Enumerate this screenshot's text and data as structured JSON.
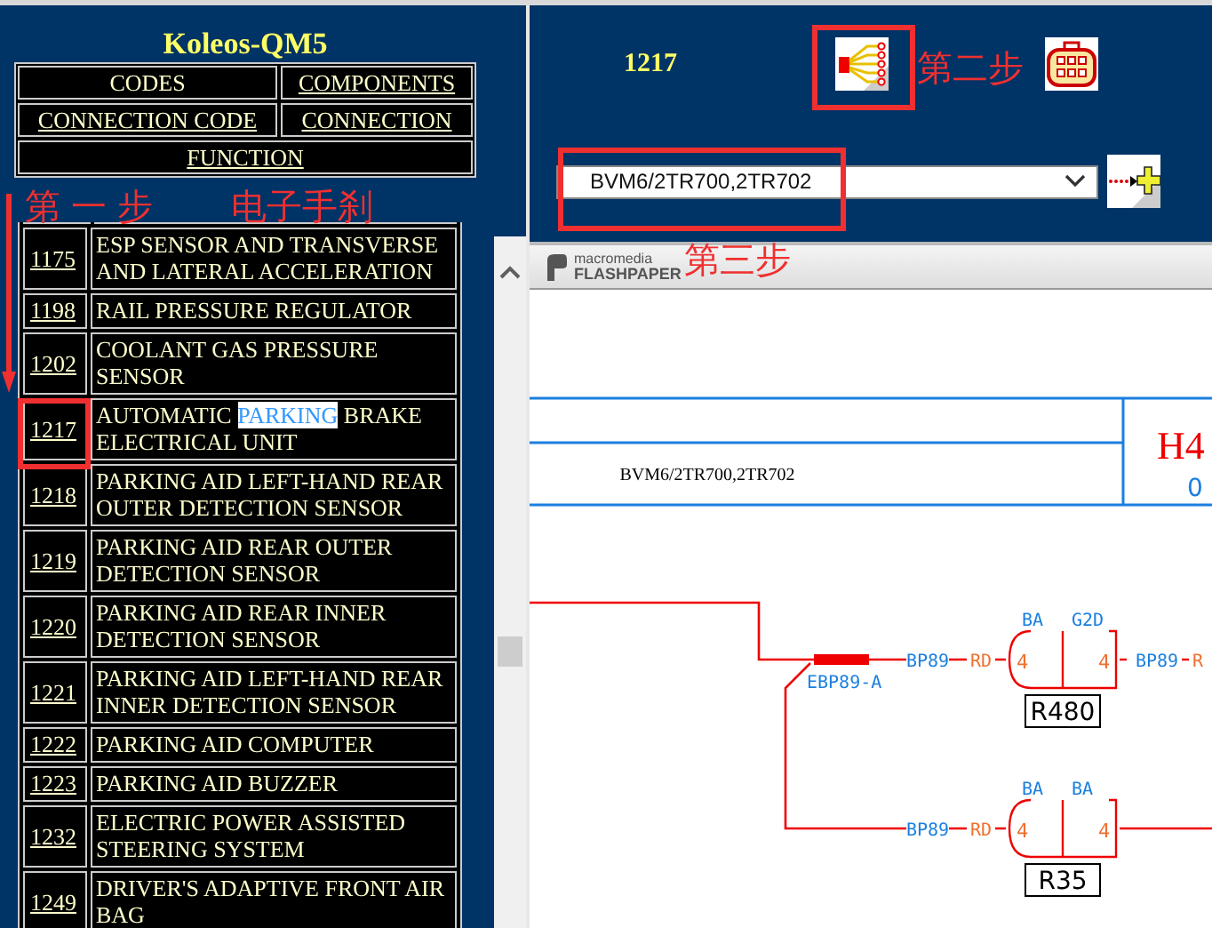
{
  "sidebar": {
    "title": "Koleos-QM5",
    "nav": [
      [
        {
          "label": "CODES",
          "selected": true
        },
        {
          "label": "COMPONENTS",
          "selected": false
        }
      ],
      [
        {
          "label": "CONNECTION CODE",
          "selected": false
        },
        {
          "label": "CONNECTION",
          "selected": false
        }
      ],
      [
        {
          "label": "FUNCTION",
          "selected": false
        }
      ]
    ],
    "components": [
      {
        "code": "1175",
        "parts": [
          {
            "text": "ESP SENSOR AND TRANSVERSE AND LATERAL ACCELERATION",
            "highlighted": false
          }
        ]
      },
      {
        "code": "1198",
        "parts": [
          {
            "text": "RAIL PRESSURE REGULATOR",
            "highlighted": false
          }
        ]
      },
      {
        "code": "1202",
        "parts": [
          {
            "text": "COOLANT GAS PRESSURE SENSOR",
            "highlighted": false
          }
        ]
      },
      {
        "code": "1217",
        "parts": [
          {
            "text": "AUTOMATIC ",
            "highlighted": false
          },
          {
            "text": "PARKING",
            "highlighted": true
          },
          {
            "text": " BRAKE ELECTRICAL UNIT",
            "highlighted": false
          }
        ]
      },
      {
        "code": "1218",
        "parts": [
          {
            "text": "PARKING AID LEFT-HAND REAR OUTER DETECTION SENSOR",
            "highlighted": false
          }
        ]
      },
      {
        "code": "1219",
        "parts": [
          {
            "text": "PARKING AID REAR OUTER DETECTION SENSOR",
            "highlighted": false
          }
        ]
      },
      {
        "code": "1220",
        "parts": [
          {
            "text": "PARKING AID REAR INNER DETECTION SENSOR",
            "highlighted": false
          }
        ]
      },
      {
        "code": "1221",
        "parts": [
          {
            "text": "PARKING AID LEFT-HAND REAR INNER DETECTION SENSOR",
            "highlighted": false
          }
        ]
      },
      {
        "code": "1222",
        "parts": [
          {
            "text": "PARKING AID COMPUTER",
            "highlighted": false
          }
        ]
      },
      {
        "code": "1223",
        "parts": [
          {
            "text": "PARKING AID BUZZER",
            "highlighted": false
          }
        ]
      },
      {
        "code": "1232",
        "parts": [
          {
            "text": "ELECTRIC POWER ASSISTED STEERING SYSTEM",
            "highlighted": false
          }
        ]
      },
      {
        "code": "1249",
        "parts": [
          {
            "text": "DRIVER'S ADAPTIVE FRONT AIR BAG",
            "highlighted": false
          }
        ]
      }
    ]
  },
  "header": {
    "code": "1217",
    "connection": "BVM6/2TR700,2TR702"
  },
  "viewer": {
    "brand": "macromedia",
    "product": "FLASHPAPER"
  },
  "diagram": {
    "title_block": {
      "code": "BVM6/2TR700,2TR702",
      "sheet": "H4",
      "ref": "0"
    },
    "splice": "EBP89-A",
    "branches": [
      {
        "wire_in": "BP89",
        "color_in": "RD",
        "pin_in": "4",
        "term_left": "BA",
        "term_right": "G2D",
        "pin_out": "4",
        "wire_out": "BP89",
        "color_out": "R",
        "connector": "R480"
      },
      {
        "wire_in": "BP89",
        "color_in": "RD",
        "pin_in": "4",
        "term_left": "BA",
        "term_right": "BA",
        "pin_out": "4",
        "connector": "R35"
      }
    ]
  },
  "annotations": [
    "第一步",
    "电子手刹",
    "第二步",
    "第三步"
  ]
}
